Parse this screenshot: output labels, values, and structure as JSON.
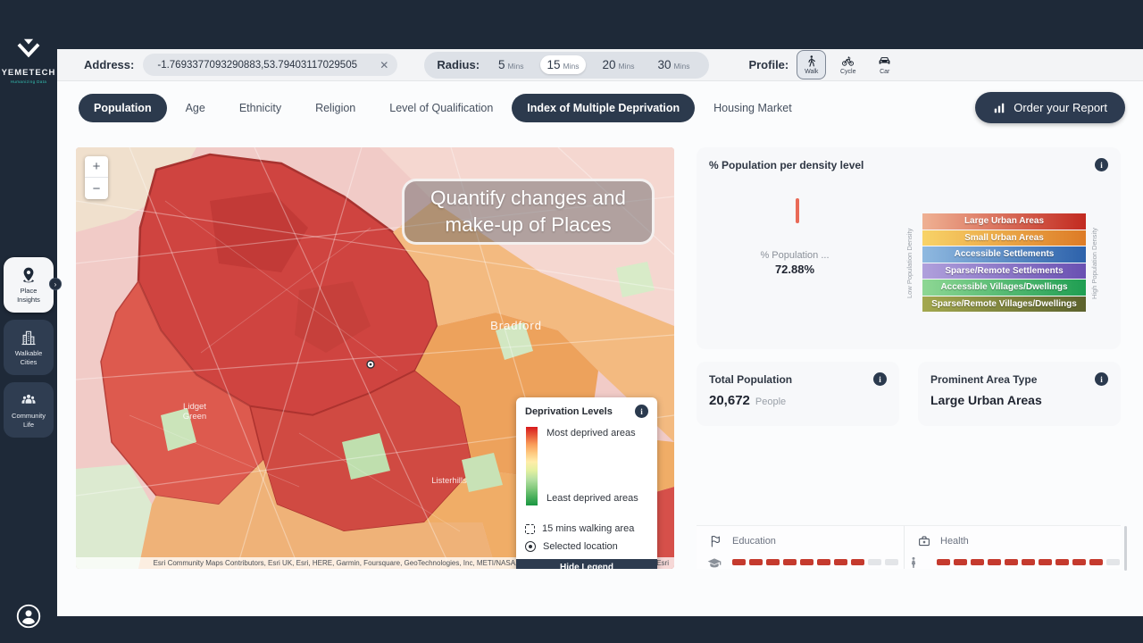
{
  "brand": {
    "name": "YEMETECH",
    "tagline": "Humanizing Data"
  },
  "topbar": {
    "address_label": "Address:",
    "address_value": "-1.7693377093290883,53.79403117029505",
    "radius_label": "Radius:",
    "radius_options": [
      {
        "value": "5",
        "unit": "Mins",
        "selected": false
      },
      {
        "value": "15",
        "unit": "Mins",
        "selected": true
      },
      {
        "value": "20",
        "unit": "Mins",
        "selected": false
      },
      {
        "value": "30",
        "unit": "Mins",
        "selected": false
      }
    ],
    "profile_label": "Profile:",
    "profile_options": [
      {
        "label": "Walk",
        "icon": "walk-icon",
        "selected": true
      },
      {
        "label": "Cycle",
        "icon": "cycle-icon",
        "selected": false
      },
      {
        "label": "Car",
        "icon": "car-icon",
        "selected": false
      }
    ]
  },
  "tabs": [
    {
      "label": "Population",
      "active": true
    },
    {
      "label": "Age",
      "active": false
    },
    {
      "label": "Ethnicity",
      "active": false
    },
    {
      "label": "Religion",
      "active": false
    },
    {
      "label": "Level of Qualification",
      "active": false
    },
    {
      "label": "Index of Multiple Deprivation",
      "active": true
    },
    {
      "label": "Housing Market",
      "active": false
    }
  ],
  "order_button": {
    "label": "Order your Report",
    "icon": "report-chart-icon"
  },
  "sidebar": {
    "items": [
      {
        "label": "Place Insights",
        "icon": "place-pin-icon",
        "active": true
      },
      {
        "label": "Walkable Cities",
        "icon": "buildings-icon",
        "active": false
      },
      {
        "label": "Community Life",
        "icon": "people-icon",
        "active": false
      }
    ]
  },
  "map": {
    "overlay_text_line1": "Quantify changes and",
    "overlay_text_line2": "make-up of Places",
    "zoom_in": "+",
    "zoom_out": "−",
    "labels": {
      "city": "Bradford",
      "area1_line1": "Lidget",
      "area1_line2": "Green",
      "area2": "Listerhills"
    },
    "legend": {
      "title": "Deprivation Levels",
      "most_label": "Most deprived areas",
      "least_label": "Least deprived areas",
      "walking_label": "15 mins walking area",
      "selected_label": "Selected location",
      "hide_button": "Hide Legend"
    },
    "attribution": "Esri Community Maps Contributors, Esri UK, Esri, HERE, Garmin, Foursquare, GeoTechnologies, Inc, METI/NASA, USGS",
    "powered_by": "Powered by Esri"
  },
  "density_panel": {
    "title": "% Population per density level",
    "gauge_label": "% Population ...",
    "gauge_value": "72.88%",
    "bar_color": "#e96a57",
    "axis_left": "Low Population Density",
    "axis_right": "High Population Density",
    "levels": [
      {
        "label": "Large Urban Areas",
        "from": "#efb193",
        "to": "#c22a20"
      },
      {
        "label": "Small Urban Areas",
        "from": "#f8d368",
        "to": "#dd7b26"
      },
      {
        "label": "Accessible Settlements",
        "from": "#8fb9e0",
        "to": "#2d62ab"
      },
      {
        "label": "Sparse/Remote Settlements",
        "from": "#b0a0dc",
        "to": "#6950b2"
      },
      {
        "label": "Accessible Villages/Dwellings",
        "from": "#8ed794",
        "to": "#1f9e52"
      },
      {
        "label": "Sparse/Remote Villages/Dwellings",
        "from": "#a3a84e",
        "to": "#5c622d"
      }
    ]
  },
  "stats": {
    "total_population": {
      "title": "Total Population",
      "value": "20,672",
      "unit": "People"
    },
    "prominent_area": {
      "title": "Prominent Area Type",
      "value": "Large Urban Areas"
    }
  },
  "bottom_panel": {
    "education": {
      "label": "Education",
      "icon": "flag-icon",
      "segments_filled": 8,
      "segments_total": 10
    },
    "health": {
      "label": "Health",
      "icon": "medkit-icon",
      "segments_filled": 10,
      "segments_total": 11
    },
    "segment_color": "#c53a2e"
  }
}
